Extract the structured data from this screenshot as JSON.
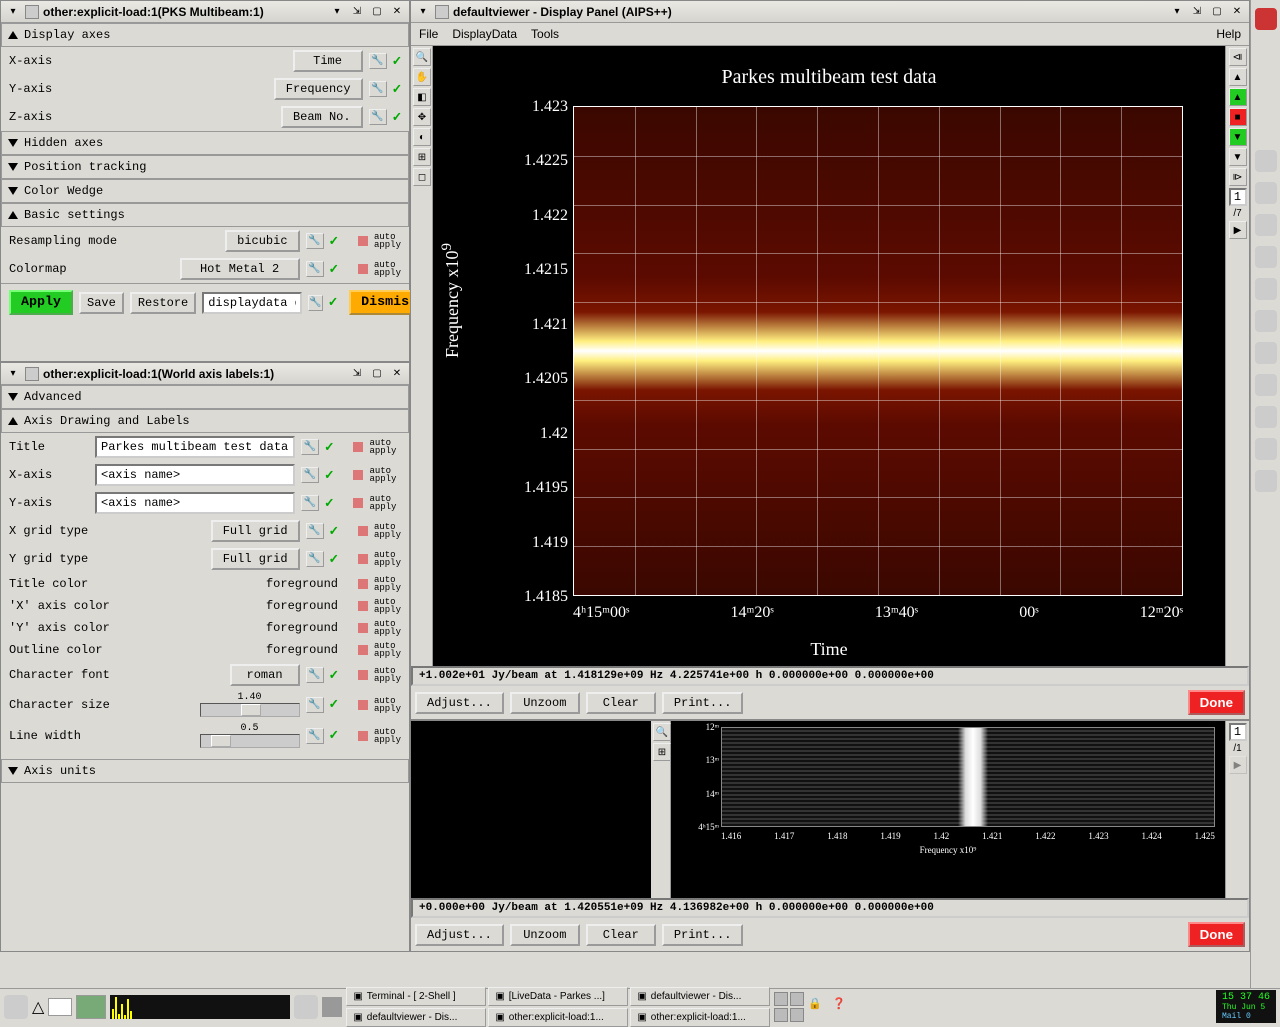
{
  "win1": {
    "title": "other:explicit-load:1(PKS Multibeam:1)",
    "sections": {
      "display_axes": "Display axes",
      "hidden_axes": "Hidden axes",
      "position_tracking": "Position tracking",
      "color_wedge": "Color Wedge",
      "basic_settings": "Basic settings"
    },
    "xaxis_label": "X-axis",
    "xaxis_val": "Time",
    "yaxis_label": "Y-axis",
    "yaxis_val": "Frequency",
    "zaxis_label": "Z-axis",
    "zaxis_val": "Beam No.",
    "resampling_label": "Resampling mode",
    "resampling_val": "bicubic",
    "colormap_label": "Colormap",
    "colormap_val": "Hot Metal 2",
    "auto_apply": "auto\napply",
    "apply": "Apply",
    "save": "Save",
    "restore": "Restore",
    "dd_field": "displaydata def",
    "dismiss": "Dismiss"
  },
  "win2": {
    "title": "other:explicit-load:1(World axis labels:1)",
    "advanced": "Advanced",
    "axis_drawing": "Axis Drawing and Labels",
    "title_label": "Title",
    "title_val": "Parkes multibeam test data",
    "xaxis_label": "X-axis",
    "xaxis_val": "<axis name>",
    "yaxis_label": "Y-axis",
    "yaxis_val": "<axis name>",
    "xgrid_label": "X grid type",
    "xgrid_val": "Full grid",
    "ygrid_label": "Y grid type",
    "ygrid_val": "Full grid",
    "titlecolor_label": "Title color",
    "titlecolor_val": "foreground",
    "xcolor_label": "'X' axis color",
    "xcolor_val": "foreground",
    "ycolor_label": "'Y' axis color",
    "ycolor_val": "foreground",
    "outline_label": "Outline color",
    "outline_val": "foreground",
    "font_label": "Character font",
    "font_val": "roman",
    "charsize_label": "Character size",
    "charsize_val": "1.40",
    "linewidth_label": "Line width",
    "linewidth_val": "0.5",
    "axis_units": "Axis units"
  },
  "viewer": {
    "title": "defaultviewer - Display Panel (AIPS++)",
    "menu": {
      "file": "File",
      "displaydata": "DisplayData",
      "tools": "Tools",
      "help": "Help"
    },
    "plot_title": "Parkes multibeam test data",
    "ylabel": "Frequency  x10",
    "ylabel_exp": "9",
    "xlabel": "Time",
    "yticks": [
      "1.423",
      "1.4225",
      "1.422",
      "1.4215",
      "1.421",
      "1.4205",
      "1.42",
      "1.4195",
      "1.419",
      "1.4185"
    ],
    "xticks": [
      "4ʰ15ᵐ00ˢ",
      "14ᵐ20ˢ",
      "13ᵐ40ˢ",
      "00ˢ",
      "12ᵐ20ˢ"
    ],
    "status": "+1.002e+01 Jy/beam at 1.418129e+09 Hz 4.225741e+00 h 0.000000e+00 0.000000e+00",
    "adjust": "Adjust...",
    "unzoom": "Unzoom",
    "clear": "Clear",
    "print": "Print...",
    "done": "Done",
    "frame": "1",
    "frame_total": "/7"
  },
  "viewer2": {
    "yticks": [
      "12ᵐ",
      "13ᵐ",
      "14ᵐ",
      "4ʰ15ᵐ"
    ],
    "xticks": [
      "1.416",
      "1.417",
      "1.418",
      "1.419",
      "1.42",
      "1.421",
      "1.422",
      "1.423",
      "1.424",
      "1.425"
    ],
    "xlabel": "Frequency  x10⁹",
    "status": "+0.000e+00 Jy/beam at 1.420551e+09 Hz 4.136982e+00 h 0.000000e+00 0.000000e+00",
    "frame": "1",
    "frame_total": "/1"
  },
  "taskbar": {
    "t1": "Terminal - [ 2-Shell ]",
    "t2": "[LiveData - Parkes ...]",
    "t3": "defaultviewer - Dis...",
    "t4": "defaultviewer - Dis...",
    "t5": "other:explicit-load:1...",
    "t6": "other:explicit-load:1...",
    "clock_time": "15 37 46",
    "clock_date": "Thu Jun 5",
    "mail": "Mail 0"
  }
}
